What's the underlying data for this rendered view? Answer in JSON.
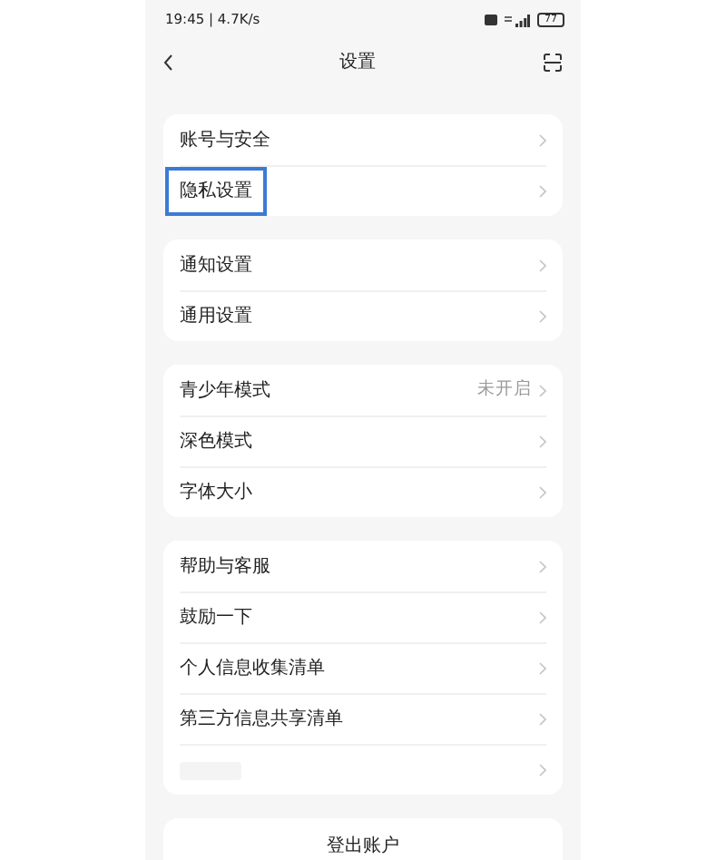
{
  "status_bar": {
    "time_speed": "19:45 | 4.7K/s",
    "battery": "77"
  },
  "header": {
    "title": "设置"
  },
  "groups": [
    {
      "items": [
        {
          "label": "账号与安全",
          "highlighted": false
        },
        {
          "label": "隐私设置",
          "highlighted": true
        }
      ]
    },
    {
      "items": [
        {
          "label": "通知设置",
          "highlighted": false
        },
        {
          "label": "通用设置",
          "highlighted": false
        }
      ]
    },
    {
      "items": [
        {
          "label": "青少年模式",
          "value": "未开启",
          "highlighted": false
        },
        {
          "label": "深色模式",
          "highlighted": false
        },
        {
          "label": "字体大小",
          "highlighted": false
        }
      ]
    },
    {
      "items": [
        {
          "label": "帮助与客服",
          "highlighted": false
        },
        {
          "label": "鼓励一下",
          "highlighted": false
        },
        {
          "label": "个人信息收集清单",
          "highlighted": false
        },
        {
          "label": "第三方信息共享清单",
          "highlighted": false
        },
        {
          "highlighted": false
        }
      ]
    }
  ],
  "logout": {
    "label": "登出账户"
  }
}
